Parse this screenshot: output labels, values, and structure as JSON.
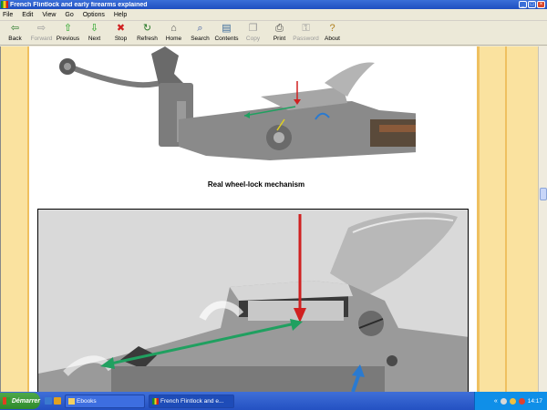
{
  "window": {
    "title": "French Flintlock and early firearms explained"
  },
  "menu": [
    "File",
    "Edit",
    "View",
    "Go",
    "Options",
    "Help"
  ],
  "toolbar": [
    {
      "label": "Back",
      "icon": "arrow-left-icon",
      "glyph": "⇦",
      "color": "#2a7a2a",
      "enabled": true
    },
    {
      "label": "Forward",
      "icon": "arrow-right-icon",
      "glyph": "⇨",
      "color": "#9a9a9a",
      "enabled": false
    },
    {
      "label": "Previous",
      "icon": "arrow-up-icon",
      "glyph": "⇧",
      "color": "#1aa01a",
      "enabled": true
    },
    {
      "label": "Next",
      "icon": "arrow-down-icon",
      "glyph": "⇩",
      "color": "#1aa01a",
      "enabled": true
    },
    {
      "label": "Stop",
      "icon": "stop-icon",
      "glyph": "✖",
      "color": "#d02020",
      "enabled": true
    },
    {
      "label": "Refresh",
      "icon": "refresh-icon",
      "glyph": "↻",
      "color": "#2a7a2a",
      "enabled": true
    },
    {
      "label": "Home",
      "icon": "home-icon",
      "glyph": "⌂",
      "color": "#555555",
      "enabled": true
    },
    {
      "label": "Search",
      "icon": "search-icon",
      "glyph": "⌕",
      "color": "#3a5aa0",
      "enabled": true
    },
    {
      "label": "Contents",
      "icon": "contents-icon",
      "glyph": "▤",
      "color": "#3a6a9a",
      "enabled": true
    },
    {
      "label": "Copy",
      "icon": "copy-icon",
      "glyph": "❐",
      "color": "#9a9a9a",
      "enabled": false
    },
    {
      "label": "Print",
      "icon": "printer-icon",
      "glyph": "⎙",
      "color": "#444444",
      "enabled": true
    },
    {
      "label": "Password",
      "icon": "key-icon",
      "glyph": "⚿",
      "color": "#9a9a9a",
      "enabled": false
    },
    {
      "label": "About",
      "icon": "help-icon",
      "glyph": "?",
      "color": "#b08020",
      "enabled": true
    }
  ],
  "content": {
    "caption": "Real wheel-lock mechanism"
  },
  "taskbar": {
    "start_label": "Démarrer",
    "tasks": [
      {
        "label": "Ebooks",
        "active": false
      },
      {
        "label": "French Flintlock and e...",
        "active": true
      }
    ],
    "clock": "14:17"
  }
}
